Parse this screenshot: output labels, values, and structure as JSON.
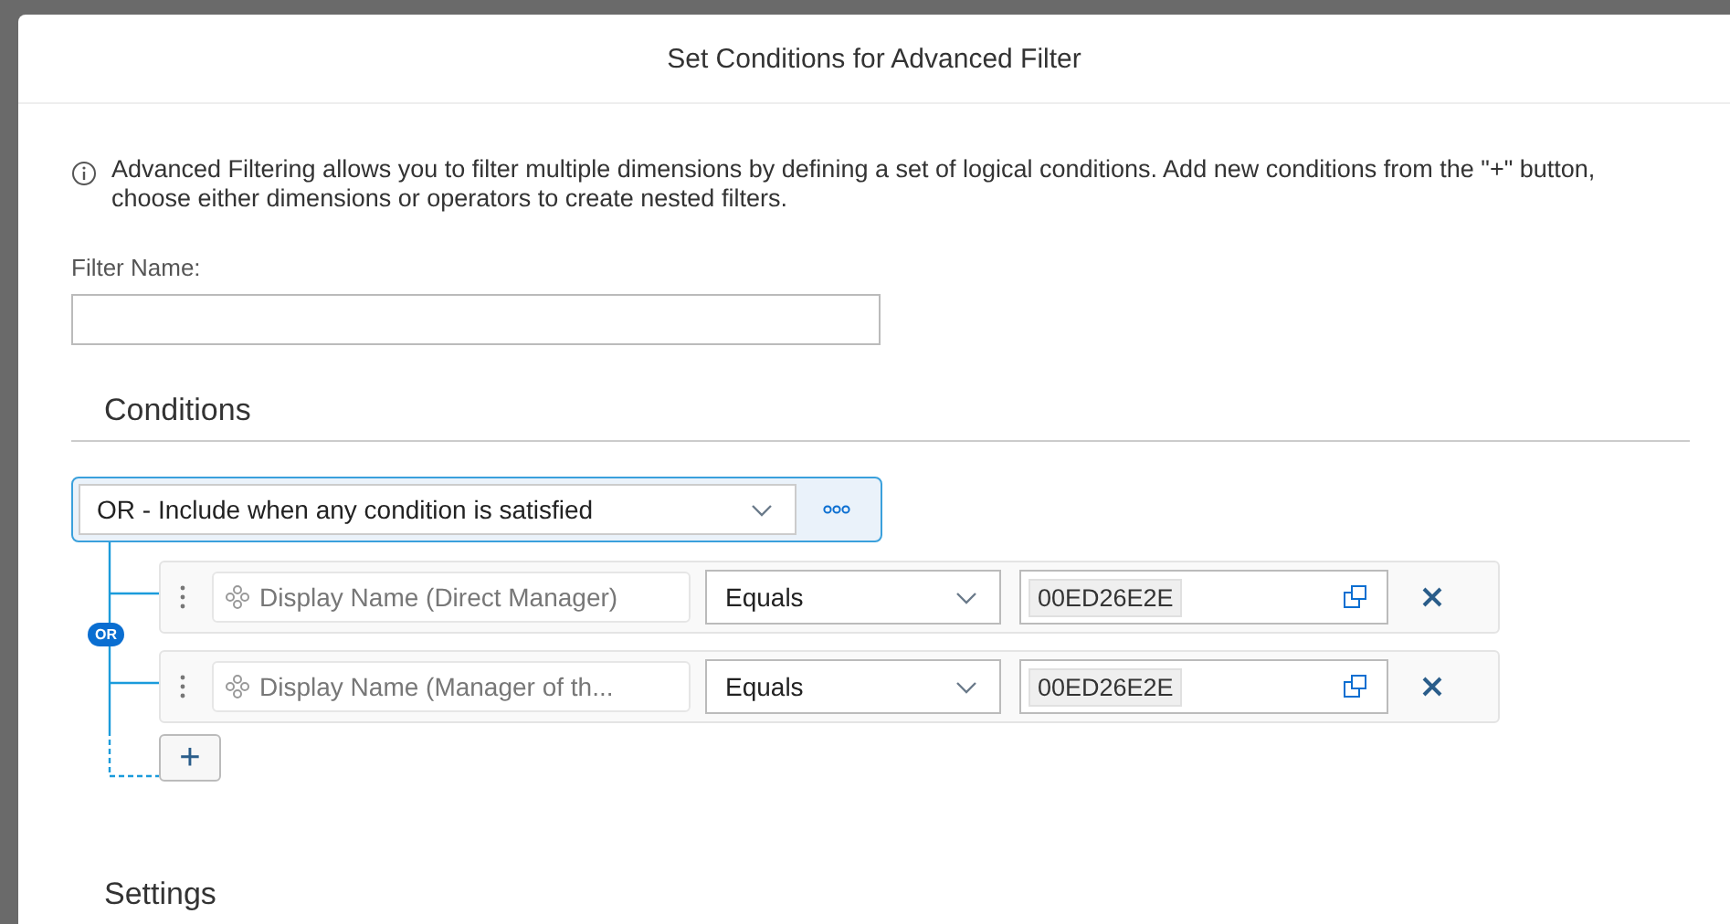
{
  "dialog": {
    "title": "Set Conditions for Advanced Filter"
  },
  "info": "Advanced Filtering allows you to filter multiple dimensions by defining a set of logical conditions. Add new conditions from the \"+\" button, choose either dimensions or operators to create nested filters.",
  "filter_name": {
    "label": "Filter Name:"
  },
  "conditions": {
    "heading": "Conditions",
    "operator": {
      "value": "OR - Include when any condition is satisfied",
      "badge": "OR"
    },
    "rows": [
      {
        "dimension": "Display Name (Direct Manager)",
        "comparison": "Equals",
        "value": "00ED26E2E"
      },
      {
        "dimension": "Display Name (Manager of th...",
        "comparison": "Equals",
        "value": "00ED26E2E"
      }
    ],
    "add_button": "+"
  },
  "settings": {
    "heading": "Settings"
  }
}
